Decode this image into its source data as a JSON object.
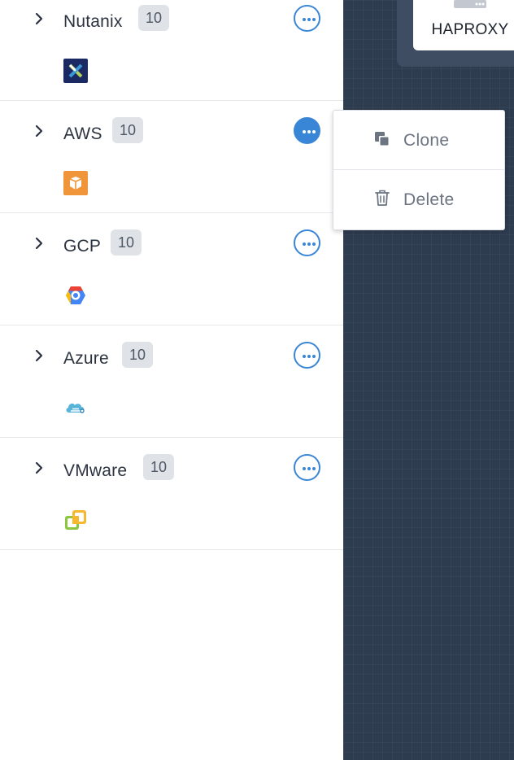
{
  "providers": [
    {
      "name": "Nutanix",
      "count": "10",
      "logo": "nutanix-logo"
    },
    {
      "name": "AWS",
      "count": "10",
      "logo": "aws-logo"
    },
    {
      "name": "GCP",
      "count": "10",
      "logo": "gcp-logo"
    },
    {
      "name": "Azure",
      "count": "10",
      "logo": "azure-logo"
    },
    {
      "name": "VMware",
      "count": "10",
      "logo": "vmware-logo"
    }
  ],
  "canvas": {
    "node_label": "HAPROXY"
  },
  "context_menu": {
    "clone_label": "Clone",
    "delete_label": "Delete"
  },
  "colors": {
    "accent": "#3a86d6",
    "canvas_bg": "#2e3c50",
    "badge_bg": "#dfe2e7"
  }
}
